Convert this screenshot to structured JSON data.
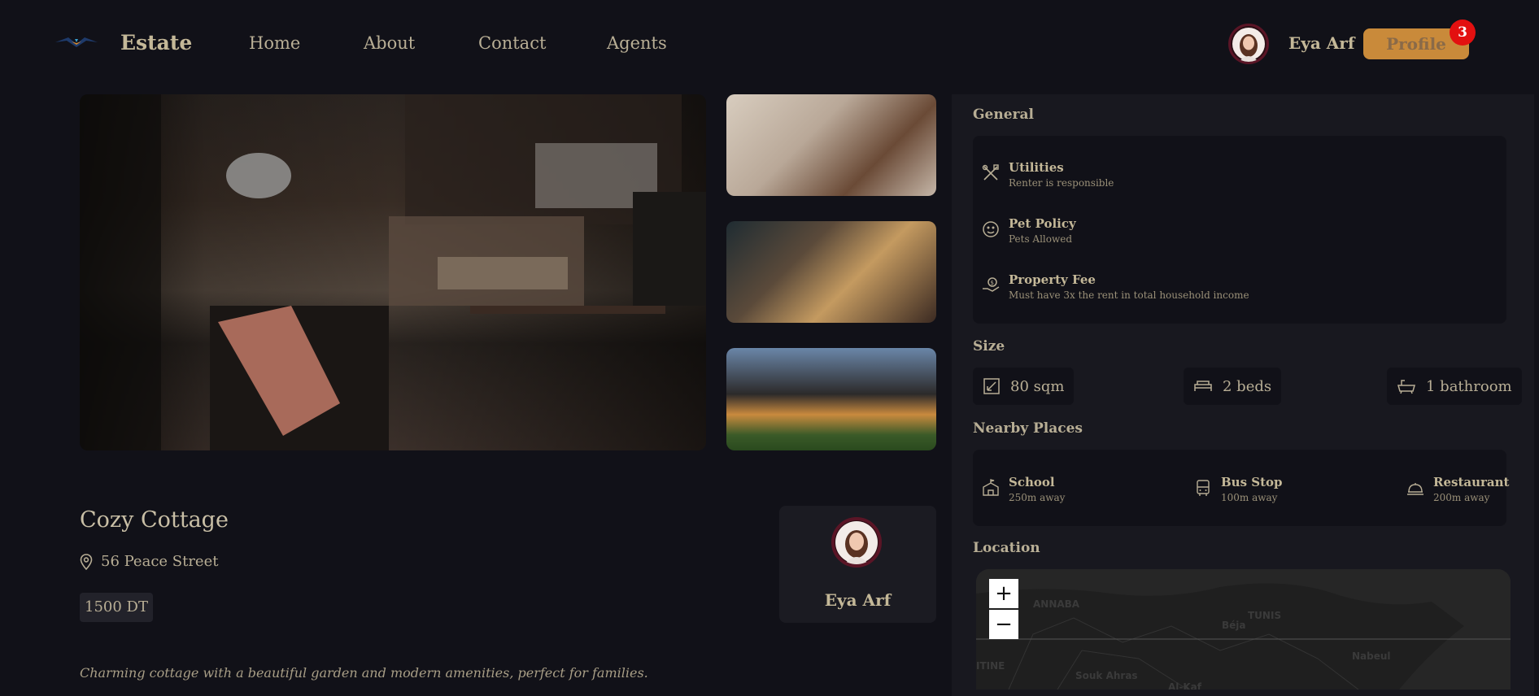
{
  "nav": {
    "brand": "Estate",
    "links": [
      "Home",
      "About",
      "Contact",
      "Agents"
    ],
    "user_name": "Eya Arf",
    "profile_label": "Profile",
    "notification_count": "3"
  },
  "property": {
    "title": "Cozy Cottage",
    "address": "56 Peace Street",
    "price": "1500 DT",
    "description": "Charming cottage with a beautiful garden and modern amenities, perfect for families."
  },
  "agent": {
    "name": "Eya Arf"
  },
  "general": {
    "heading": "General",
    "items": [
      {
        "title": "Utilities",
        "subtitle": "Renter is responsible",
        "icon": "tools-icon"
      },
      {
        "title": "Pet Policy",
        "subtitle": "Pets Allowed",
        "icon": "pet-icon"
      },
      {
        "title": "Property Fee",
        "subtitle": "Must have 3x the rent in total household income",
        "icon": "fee-icon"
      }
    ]
  },
  "size": {
    "heading": "Size",
    "area": "80 sqm",
    "beds": "2 beds",
    "bathrooms": "1 bathroom"
  },
  "nearby": {
    "heading": "Nearby Places",
    "items": [
      {
        "title": "School",
        "subtitle": "250m away",
        "icon": "school-icon"
      },
      {
        "title": "Bus Stop",
        "subtitle": "100m away",
        "icon": "bus-icon"
      },
      {
        "title": "Restaurant",
        "subtitle": "200m away",
        "icon": "restaurant-icon"
      }
    ]
  },
  "location": {
    "heading": "Location",
    "zoom_in": "+",
    "zoom_out": "−",
    "map_labels": [
      "ANNABA",
      "TUNIS",
      "Béja",
      "Nabeul",
      "Souk Ahras",
      "Al-Kaf",
      "ITINE"
    ]
  },
  "colors": {
    "accent": "#c98a3a",
    "badge": "#e31010",
    "background": "#111118",
    "panel": "#18181f"
  }
}
